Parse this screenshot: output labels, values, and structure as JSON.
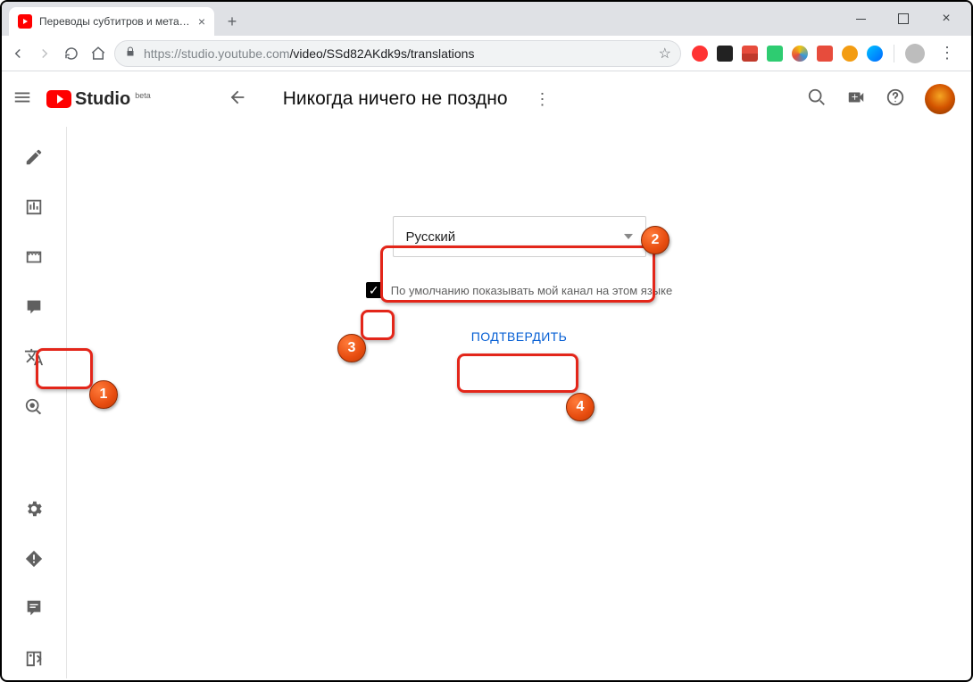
{
  "browser": {
    "tab_title": "Переводы субтитров и метадан…",
    "url_host": "https://studio.youtube.com",
    "url_path": "/video/SSd82AKdk9s/translations"
  },
  "header": {
    "logo_text": "Studio",
    "logo_badge": "beta",
    "video_title": "Никогда ничего не поздно"
  },
  "form": {
    "language_selected": "Русский",
    "checkbox_checked": true,
    "checkbox_label": "По умолчанию показывать мой канал на этом языке",
    "confirm_label": "ПОДТВЕРДИТЬ"
  },
  "annotations": {
    "b1": "1",
    "b2": "2",
    "b3": "3",
    "b4": "4"
  }
}
